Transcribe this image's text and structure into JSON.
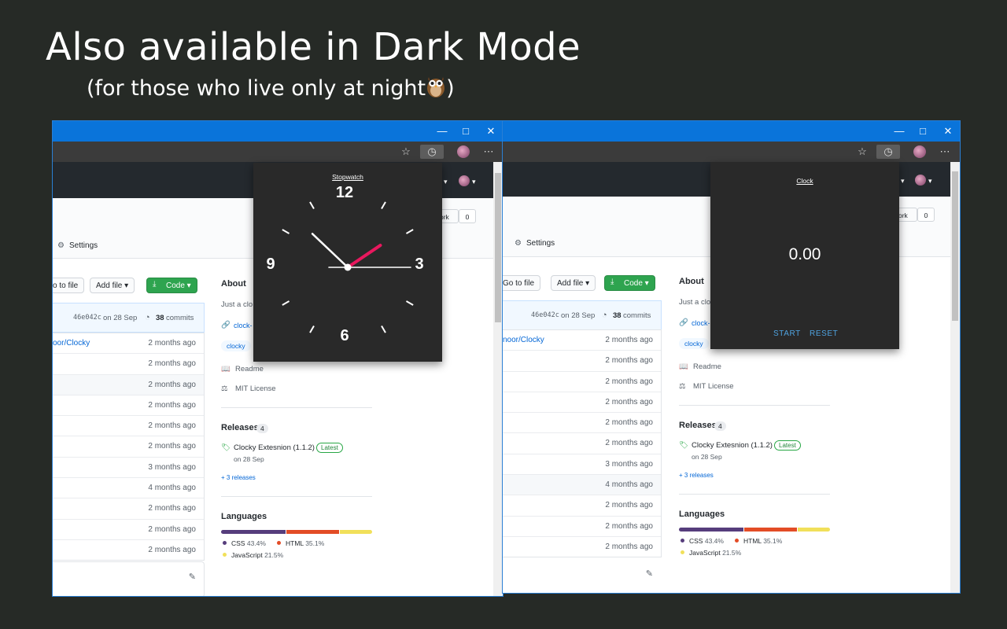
{
  "promo": {
    "headline": "Also available in Dark Mode",
    "subline_before": "(for those who live only at night",
    "subline_after": ")",
    "owl_icon": "owl-emoji"
  },
  "colors": {
    "background": "#262a26",
    "titlebar": "#0a74da",
    "popup": "#292929",
    "accent_link": "#0366d6",
    "code_button": "#2ea44f",
    "hand_red": "#e8185e"
  },
  "window_controls": {
    "minimize": "—",
    "maximize": "□",
    "close": "✕"
  },
  "left": {
    "settings_label": "Settings",
    "fork_label": "ork",
    "fork_count": "0",
    "goto_file": "o to file",
    "add_file": "Add file ▾",
    "code": "Code ▾",
    "commit_hash": "46e042c",
    "commit_date": "on 28 Sep",
    "commit_count": "38",
    "commits_label": "commits",
    "rows": [
      {
        "name": "oor/Clocky",
        "ago": "2 months ago"
      },
      {
        "name": "",
        "ago": "2 months ago"
      },
      {
        "name": "",
        "ago": "2 months ago"
      },
      {
        "name": "",
        "ago": "2 months ago"
      },
      {
        "name": "",
        "ago": "2 months ago"
      },
      {
        "name": "",
        "ago": "2 months ago"
      },
      {
        "name": "",
        "ago": "3 months ago"
      },
      {
        "name": "",
        "ago": "4 months ago"
      },
      {
        "name": "",
        "ago": "2 months ago"
      },
      {
        "name": "",
        "ago": "2 months ago"
      },
      {
        "name": "",
        "ago": "2 months ago"
      }
    ],
    "about_heading": "About",
    "about_text": "Just a clo",
    "about_link": "clock-",
    "topic": "clocky",
    "readme": "Readme",
    "license": "MIT License",
    "releases_heading": "Releases",
    "releases_count": "4",
    "release_name": "Clocky Extesnion (1.1.2)",
    "latest_label": "Latest",
    "release_date": "on 28 Sep",
    "more_releases": "+ 3 releases",
    "languages_heading": "Languages",
    "languages": [
      {
        "name": "CSS",
        "percent": "43.4%",
        "value": 43.4,
        "color": "#563d7c"
      },
      {
        "name": "HTML",
        "percent": "35.1%",
        "value": 35.1,
        "color": "#e34c26"
      },
      {
        "name": "JavaScript",
        "percent": "21.5%",
        "value": 21.5,
        "color": "#f1e05a"
      }
    ]
  },
  "right": {
    "settings_label": "Settings",
    "fork_label": "ork",
    "fork_count": "0",
    "goto_file": "Go to file",
    "add_file": "Add file ▾",
    "code": "Code ▾",
    "commit_hash": "46e042c",
    "commit_date": "on 28 Sep",
    "commit_count": "38",
    "commits_label": "commits",
    "rows": [
      {
        "name": "noor/Clocky",
        "ago": "2 months ago"
      },
      {
        "name": "",
        "ago": "2 months ago"
      },
      {
        "name": "",
        "ago": "2 months ago"
      },
      {
        "name": "",
        "ago": "2 months ago"
      },
      {
        "name": "",
        "ago": "2 months ago"
      },
      {
        "name": "",
        "ago": "2 months ago"
      },
      {
        "name": "",
        "ago": "3 months ago"
      },
      {
        "name": "",
        "ago": "4 months ago"
      },
      {
        "name": "",
        "ago": "2 months ago"
      },
      {
        "name": "",
        "ago": "2 months ago"
      },
      {
        "name": "",
        "ago": "2 months ago"
      }
    ],
    "about_heading": "About",
    "about_text": "Just a clo",
    "about_link": "clock-",
    "topic": "clocky",
    "readme": "Readme",
    "license": "MIT License",
    "releases_heading": "Releases",
    "releases_count": "4",
    "release_name": "Clocky Extesnion (1.1.2)",
    "latest_label": "Latest",
    "release_date": "on 28 Sep",
    "more_releases": "+ 3 releases",
    "languages_heading": "Languages",
    "languages": [
      {
        "name": "CSS",
        "percent": "43.4%",
        "value": 43.4,
        "color": "#563d7c"
      },
      {
        "name": "HTML",
        "percent": "35.1%",
        "value": 35.1,
        "color": "#e34c26"
      },
      {
        "name": "JavaScript",
        "percent": "21.5%",
        "value": 21.5,
        "color": "#f1e05a"
      }
    ]
  },
  "clock_popup": {
    "mode_link": "Stopwatch",
    "numerals": {
      "n12": "12",
      "n3": "3",
      "n6": "6",
      "n9": "9"
    },
    "time": {
      "hour": 1,
      "minute": 52,
      "second": 15
    }
  },
  "stopwatch_popup": {
    "mode_link": "Clock",
    "elapsed": "0.00",
    "start_label": "START",
    "reset_label": "RESET"
  }
}
